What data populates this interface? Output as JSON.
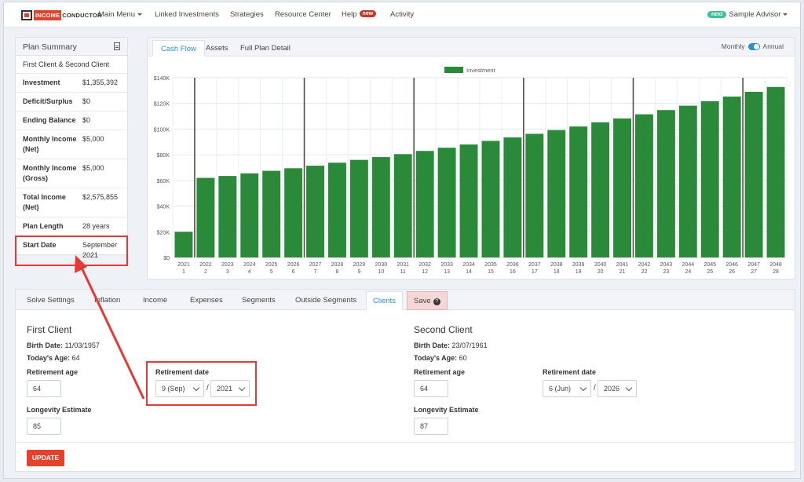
{
  "nav": {
    "logo_part1": "INCOME",
    "logo_part2": "CONDUCTOR",
    "main_menu": "Main Menu",
    "linked_investments": "Linked Investments",
    "strategies": "Strategies",
    "resource_center": "Resource Center",
    "help": "Help",
    "help_badge": "new",
    "activity": "Activity",
    "user_badge": "next",
    "user_name": "Sample Advisor"
  },
  "summary": {
    "title": "Plan Summary",
    "clients": "First Client & Second Client",
    "rows": [
      {
        "label": "Investment",
        "value": "$1,355,392"
      },
      {
        "label": "Deficit/Surplus",
        "value": "$0"
      },
      {
        "label": "Ending Balance",
        "value": "$0"
      },
      {
        "label": "Monthly Income (Net)",
        "value": "$5,000"
      },
      {
        "label": "Monthly Income (Gross)",
        "value": "$5,000"
      },
      {
        "label": "Total Income (Net)",
        "value": "$2,575,855"
      },
      {
        "label": "Plan Length",
        "value": "28 years"
      },
      {
        "label": "Start Date",
        "value": "September 2021"
      }
    ]
  },
  "chart_tabs": [
    "Cash Flow",
    "Assets",
    "Full Plan Detail"
  ],
  "toggle": {
    "left": "Monthly",
    "right": "Annual"
  },
  "chart_data": {
    "type": "bar",
    "legend": "Investment",
    "color": "#2a8a3a",
    "years": [
      "2021",
      "2022",
      "2023",
      "2024",
      "2025",
      "2026",
      "2027",
      "2028",
      "2029",
      "2030",
      "2031",
      "2032",
      "2033",
      "2034",
      "2035",
      "2036",
      "2037",
      "2038",
      "2039",
      "2040",
      "2041",
      "2042",
      "2043",
      "2044",
      "2045",
      "2046",
      "2047",
      "2048"
    ],
    "periods": [
      "1",
      "2",
      "3",
      "4",
      "5",
      "6",
      "7",
      "8",
      "9",
      "10",
      "11",
      "12",
      "13",
      "14",
      "15",
      "16",
      "17",
      "18",
      "19",
      "20",
      "21",
      "22",
      "23",
      "24",
      "25",
      "26",
      "27",
      "28"
    ],
    "values": [
      20000,
      62000,
      63500,
      65500,
      67500,
      69500,
      71500,
      73800,
      76000,
      78200,
      80500,
      83000,
      85500,
      88000,
      90800,
      93500,
      96300,
      99200,
      102000,
      105300,
      108300,
      111500,
      114800,
      118200,
      121700,
      125300,
      129000,
      132800
    ],
    "yticks": [
      "$0",
      "$20K",
      "$40K",
      "$60K",
      "$80K",
      "$100K",
      "$120K",
      "$140K"
    ],
    "ylim": [
      0,
      140000
    ],
    "markers_after_years": [
      "2021",
      "2026",
      "2031",
      "2036",
      "2041",
      "2046"
    ]
  },
  "bottom_tabs": [
    "Solve Settings",
    "Inflation",
    "Income",
    "Expenses",
    "Segments",
    "Outside Segments",
    "Clients",
    "Save"
  ],
  "first_client": {
    "title": "First Client",
    "birth_label": "Birth Date:",
    "birth_date": "11/03/1957",
    "age_label": "Today's Age:",
    "age": "64",
    "retirement_age_label": "Retirement age",
    "retirement_age": "64",
    "retirement_date_label": "Retirement date",
    "ret_month": "9 (Sep)",
    "ret_year": "2021",
    "longevity_label": "Longevity Estimate",
    "longevity": "85"
  },
  "second_client": {
    "title": "Second Client",
    "birth_label": "Birth Date:",
    "birth_date": "23/07/1961",
    "age_label": "Today's Age:",
    "age": "60",
    "retirement_age_label": "Retirement age",
    "retirement_age": "64",
    "retirement_date_label": "Retirement date",
    "ret_month": "6 (Jun)",
    "ret_year": "2026",
    "longevity_label": "Longevity Estimate",
    "longevity": "87"
  },
  "update_button": "UPDATE",
  "slash": "/",
  "colors": {
    "accent": "#2a8fd6",
    "brand": "#e2432d",
    "bar": "#2a8a3a",
    "highlight": "#e53935"
  }
}
